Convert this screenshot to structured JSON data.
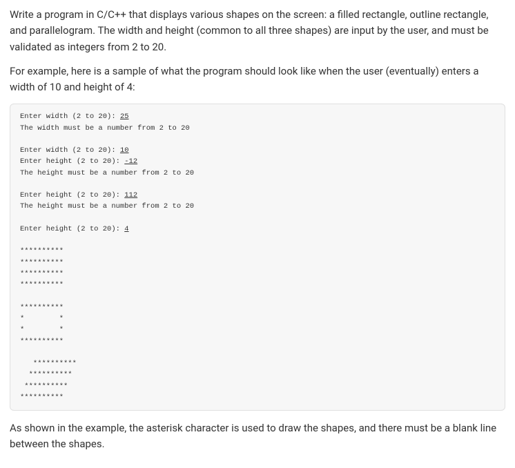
{
  "intro": {
    "p1": "Write a program in C/C++ that displays various shapes on the screen: a filled rectangle, outline rectangle, and parallelogram. The width and height (common to all three shapes) are input by the user, and must be validated as integers from 2 to 20.",
    "p2": "For example, here is a sample of what the program should look like when the user (eventually) enters a width of 10 and height of 4:"
  },
  "code": {
    "l1a": "Enter width (2 to 20): ",
    "l1b": "25",
    "l2": "The width must be a number from 2 to 20",
    "l3a": "Enter width (2 to 20): ",
    "l3b": "10",
    "l4a": "Enter height (2 to 20): ",
    "l4b": "-12",
    "l5": "The height must be a number from 2 to 20",
    "l6a": "Enter height (2 to 20): ",
    "l6b": "112",
    "l7": "The height must be a number from 2 to 20",
    "l8a": "Enter height (2 to 20): ",
    "l8b": "4",
    "s1r1": "**********",
    "s1r2": "**********",
    "s1r3": "**********",
    "s1r4": "**********",
    "s2r1": "**********",
    "s2r2": "*        *",
    "s2r3": "*        *",
    "s2r4": "**********",
    "s3r1": "   **********",
    "s3r2": "  **********",
    "s3r3": " **********",
    "s3r4": "**********"
  },
  "outro": {
    "p1": "As shown in the example, the asterisk character is used to draw the shapes, and there must be a blank line between the shapes."
  }
}
